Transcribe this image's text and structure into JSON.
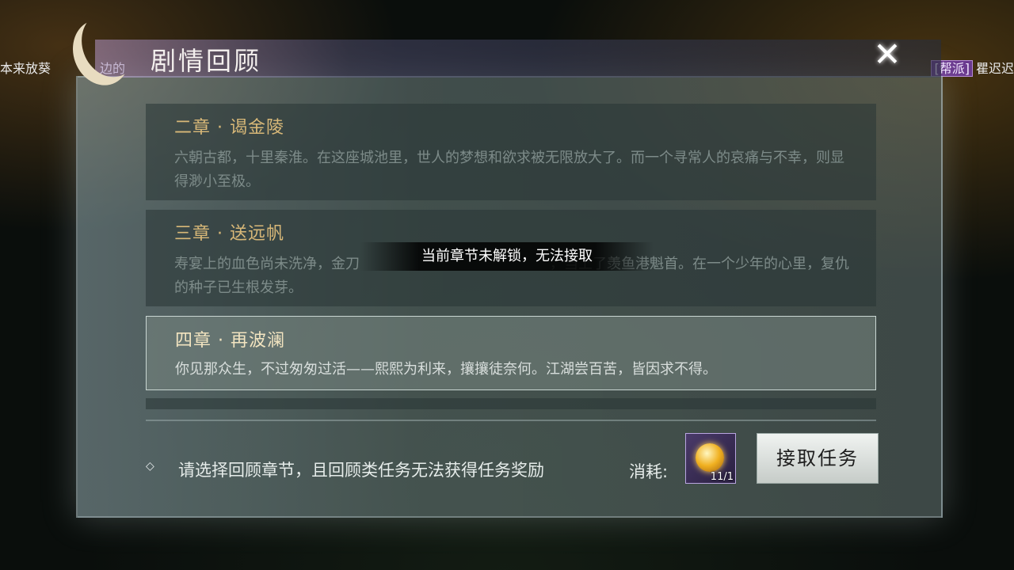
{
  "header": {
    "title": "剧情回顾",
    "close_icon": "close-icon"
  },
  "ticker": {
    "left": "本来放葵",
    "left_tail": "边的",
    "right_tag": "[帮派]",
    "right_text": "瞿迟迟"
  },
  "chapters": [
    {
      "title": "二章 · 谒金陵",
      "desc": "六朝古都，十里秦淮。在这座城池里，世人的梦想和欲求被无限放大了。而一个寻常人的哀痛与不幸，则显得渺小至极。"
    },
    {
      "title": "三章 · 送远帆",
      "desc": "寿宴上的血色尚未洗净，金刀",
      "desc2": "，当上了羡鱼港魁首。在一个少年的心里，复仇的种子已生根发芽。"
    },
    {
      "title": "四章 · 再波澜",
      "desc": "你见那众生，不过匆匆过活——熙熙为利来，攘攘徒奈何。江湖尝百苦，皆因求不得。"
    }
  ],
  "toast": "当前章节未解锁，无法接取",
  "footer": {
    "hint": "请选择回顾章节，且回顾类任务无法获得任务奖励",
    "cost_label": "消耗:",
    "item_count": "11/1",
    "accept_label": "接取任务"
  }
}
